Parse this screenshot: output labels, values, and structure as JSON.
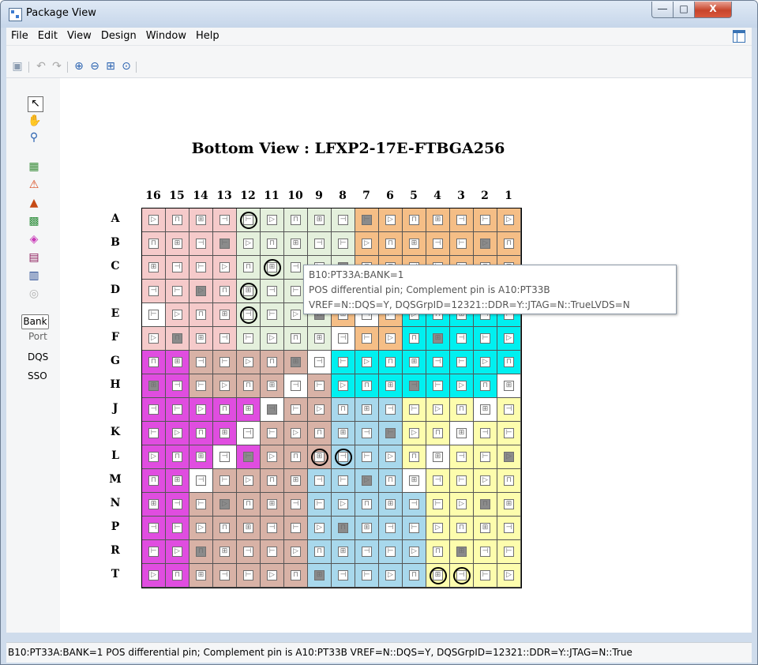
{
  "window": {
    "title": "Package View"
  },
  "menu": [
    "File",
    "Edit",
    "View",
    "Design",
    "Window",
    "Help"
  ],
  "toolbar": {
    "icons": [
      "save-icon",
      "undo-icon",
      "redo-icon",
      "zoom-in-icon",
      "zoom-out-icon",
      "zoom-fit-icon",
      "zoom-area-icon"
    ]
  },
  "left_toolbar": {
    "tools": [
      "select-arrow-icon",
      "pan-hand-icon",
      "zoom-icon",
      "pin-assign-icon",
      "warning-icon",
      "error-icon",
      "bank-color-icon",
      "shape-icon",
      "grid-view-icon",
      "flip-view-icon",
      "disabled-tool-icon"
    ],
    "view_tabs": [
      "Bank",
      "Port",
      "DQS",
      "SSO"
    ],
    "active_tab": "Bank"
  },
  "view": {
    "title": "Bottom View : LFXP2-17E-FTBGA256",
    "columns": [
      "16",
      "15",
      "14",
      "13",
      "12",
      "11",
      "10",
      "9",
      "8",
      "7",
      "6",
      "5",
      "4",
      "3",
      "2",
      "1"
    ],
    "rows": [
      "A",
      "B",
      "C",
      "D",
      "E",
      "F",
      "G",
      "H",
      "J",
      "K",
      "L",
      "M",
      "N",
      "P",
      "R",
      "T"
    ],
    "bank_colors": {
      "bank0": "#f5be86",
      "bank1": "#f5caca",
      "bank2": "#e4f0dc",
      "bank3": "#00f0f0",
      "bank4": "#fdfdad",
      "bank5": "#a8d8ec",
      "bank6": "#d8b2a6",
      "bank7": "#e04de0",
      "white": "#ffffff"
    },
    "dqs_cells": [
      "A12",
      "C11",
      "D12",
      "E12",
      "L9",
      "L8",
      "T4",
      "T3"
    ]
  },
  "tooltip": {
    "line1": "B10:PT33A:BANK=1",
    "line2": "POS differential pin; Complement pin is A10:PT33B",
    "line3": "VREF=N::DQS=Y, DQSGrpID=12321::DDR=Y::JTAG=N::TrueLVDS=N"
  },
  "status": {
    "text": "B10:PT33A:BANK=1 POS differential pin; Complement pin is A10:PT33B VREF=N::DQS=Y, DQSGrpID=12321::DDR=Y::JTAG=N::True"
  }
}
